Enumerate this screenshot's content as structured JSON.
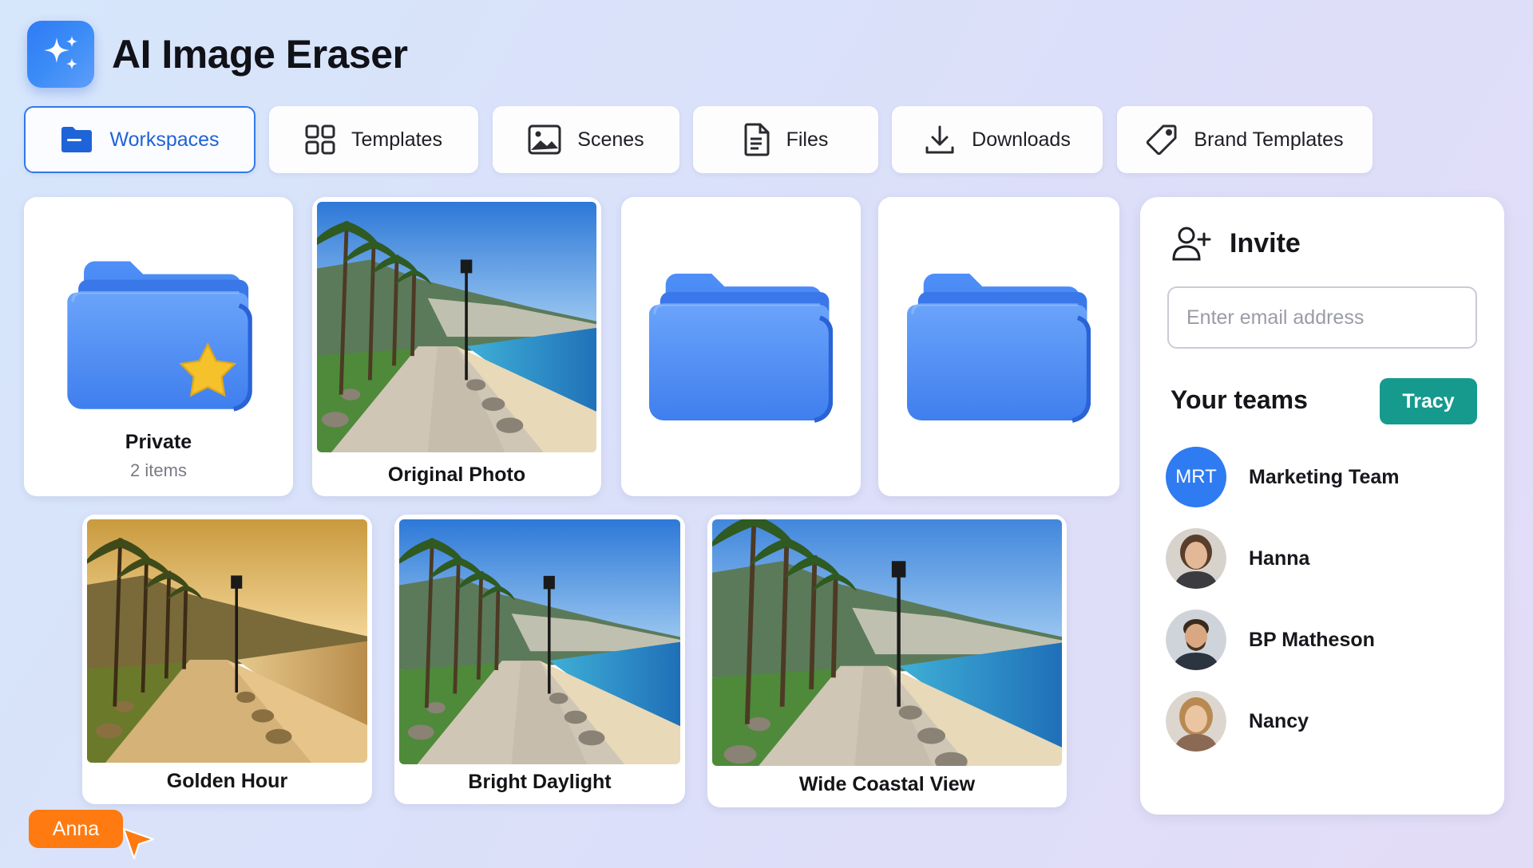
{
  "app": {
    "title": "AI Image Eraser",
    "logo_icon": "sparkles-icon",
    "accent": "#3179ec"
  },
  "tabs": [
    {
      "label": "Workspaces",
      "icon": "folder-icon",
      "active": true
    },
    {
      "label": "Templates",
      "icon": "grid-icon",
      "active": false
    },
    {
      "label": "Scenes",
      "icon": "image-icon",
      "active": false
    },
    {
      "label": "Files",
      "icon": "file-icon",
      "active": false
    },
    {
      "label": "Downloads",
      "icon": "download-icon",
      "active": false
    },
    {
      "label": "Brand Templates",
      "icon": "tag-icon",
      "active": false
    }
  ],
  "cards_row1": [
    {
      "label": "Private",
      "sub": "2 items",
      "kind": "folder-star"
    },
    {
      "label": "Original Photo",
      "kind": "photo-day"
    },
    {
      "label": "",
      "kind": "folder"
    },
    {
      "label": "",
      "kind": "folder"
    }
  ],
  "cards_row2": [
    {
      "label": "Golden Hour",
      "kind": "photo-golden"
    },
    {
      "label": "Bright Daylight",
      "kind": "photo-day"
    },
    {
      "label": "Wide Coastal View",
      "kind": "photo-wide"
    }
  ],
  "invite": {
    "title": "Invite",
    "icon": "add-user-icon",
    "email_placeholder": "Enter email address",
    "teams_title": "Your teams",
    "teams_button": "Tracy",
    "teams_button_color": "#169a8d",
    "members": [
      {
        "initials": "MRT",
        "name": "Marketing Team"
      },
      {
        "name": "Hanna"
      },
      {
        "name": "BP Matheson"
      },
      {
        "name": "Nancy"
      }
    ]
  },
  "cursor": {
    "label": "Anna",
    "color": "#ff7a10"
  }
}
